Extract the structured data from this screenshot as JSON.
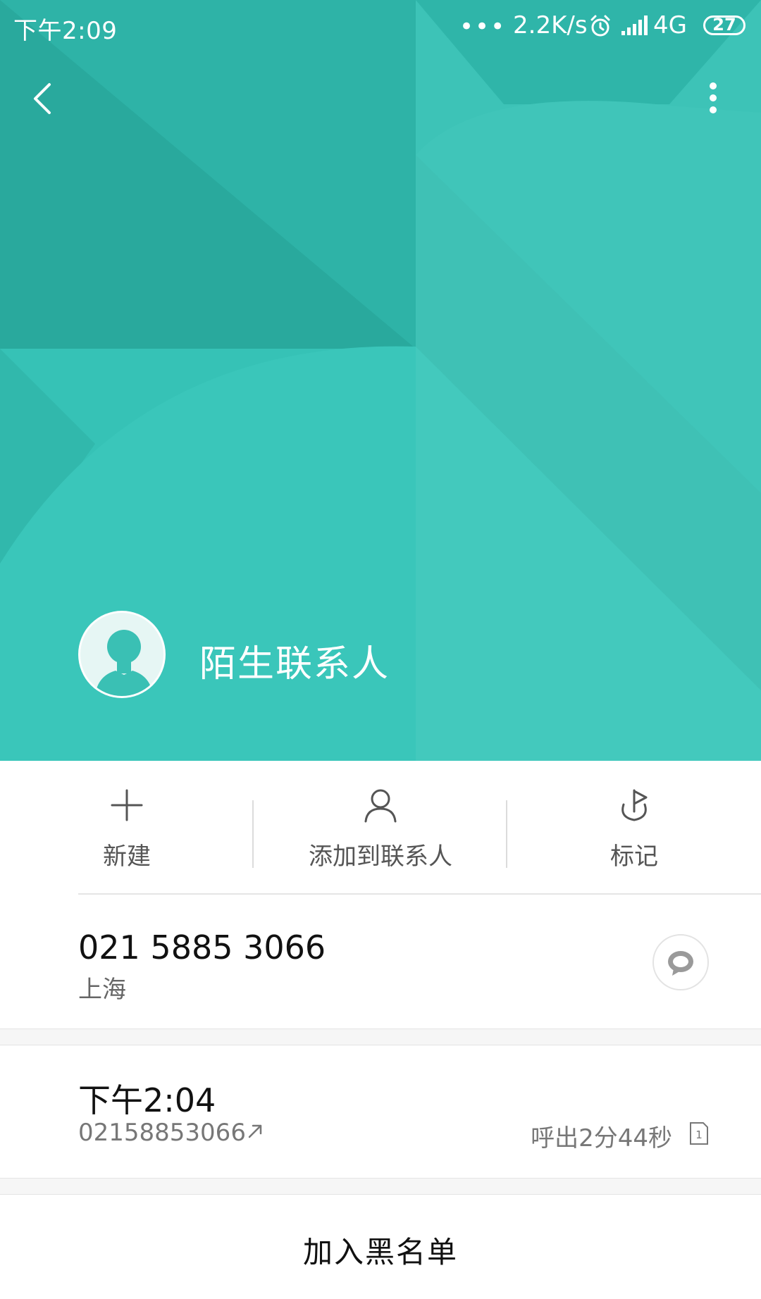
{
  "status_bar": {
    "time": "下午2:09",
    "dots": "•••",
    "network_speed": "2.2K/s",
    "network_type": "4G",
    "battery": "27"
  },
  "header": {
    "contact_name": "陌生联系人",
    "background_color": "#33bdb1"
  },
  "actions": {
    "new_label": "新建",
    "add_contact_label": "添加到联系人",
    "mark_label": "标记"
  },
  "phone": {
    "number": "021 5885 3066",
    "location": "上海"
  },
  "call_log": {
    "time": "下午2:04",
    "number": "02158853066",
    "detail": "呼出2分44秒",
    "sim": "1"
  },
  "blacklist": {
    "label": "加入黑名单"
  }
}
